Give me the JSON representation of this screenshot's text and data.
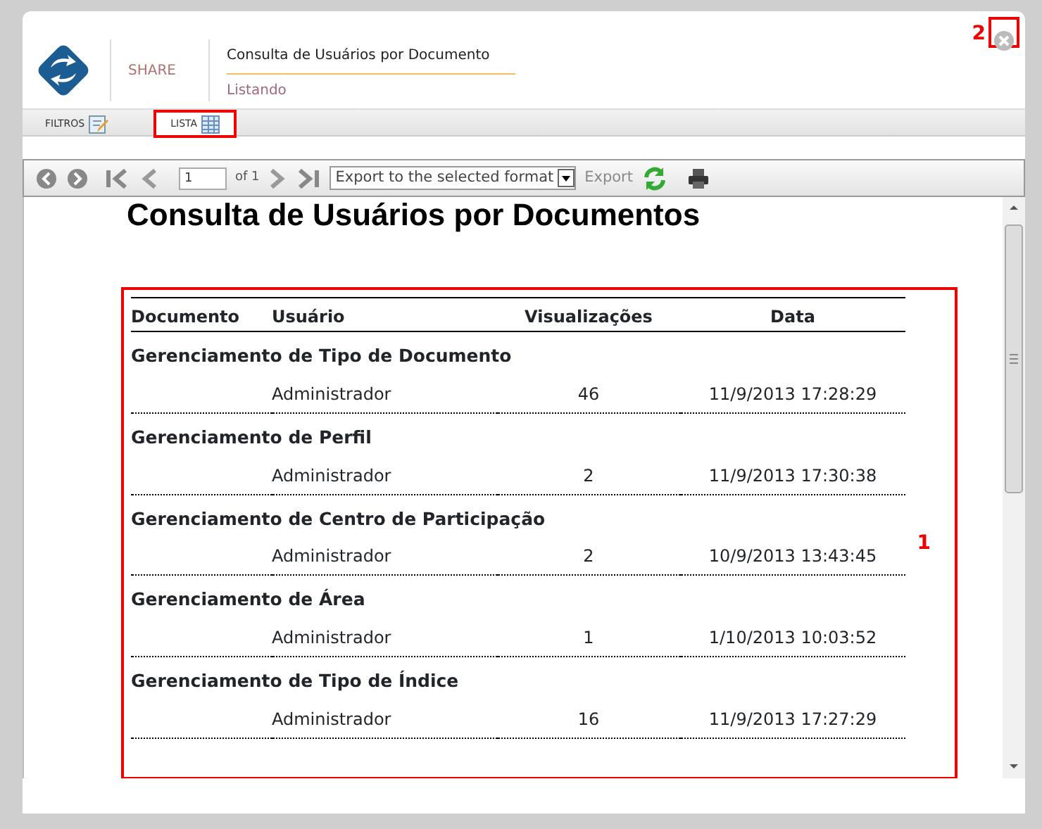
{
  "header": {
    "app": "SHARE",
    "title": "Consulta de Usuários por Documento",
    "subtitle": "Listando",
    "close_annotation": "2",
    "close_highlighted": true
  },
  "tabs": [
    {
      "label": "FILTROS",
      "selected": false,
      "highlighted": false
    },
    {
      "label": "LISTA",
      "selected": true,
      "highlighted": true
    }
  ],
  "toolbar": {
    "page": "1",
    "of": "of 1",
    "export_format": "Export to the selected format",
    "export": "Export"
  },
  "report": {
    "title": "Consulta de Usuários por Documentos",
    "annotation": "1",
    "highlighted": true,
    "columns": [
      "Documento",
      "Usuário",
      "Visualizações",
      "Data"
    ],
    "groups": [
      {
        "document": "Gerenciamento de Tipo de Documento",
        "user": "Administrador",
        "views": "46",
        "date": "11/9/2013 17:28:29"
      },
      {
        "document": "Gerenciamento de Perfil",
        "user": "Administrador",
        "views": "2",
        "date": "11/9/2013 17:30:38"
      },
      {
        "document": "Gerenciamento de Centro de Participação",
        "user": "Administrador",
        "views": "2",
        "date": "10/9/2013 13:43:45"
      },
      {
        "document": "Gerenciamento de Área",
        "user": "Administrador",
        "views": "1",
        "date": "1/10/2013 10:03:52"
      },
      {
        "document": "Gerenciamento de Tipo de Índice",
        "user": "Administrador",
        "views": "16",
        "date": "11/9/2013 17:27:29"
      }
    ]
  }
}
